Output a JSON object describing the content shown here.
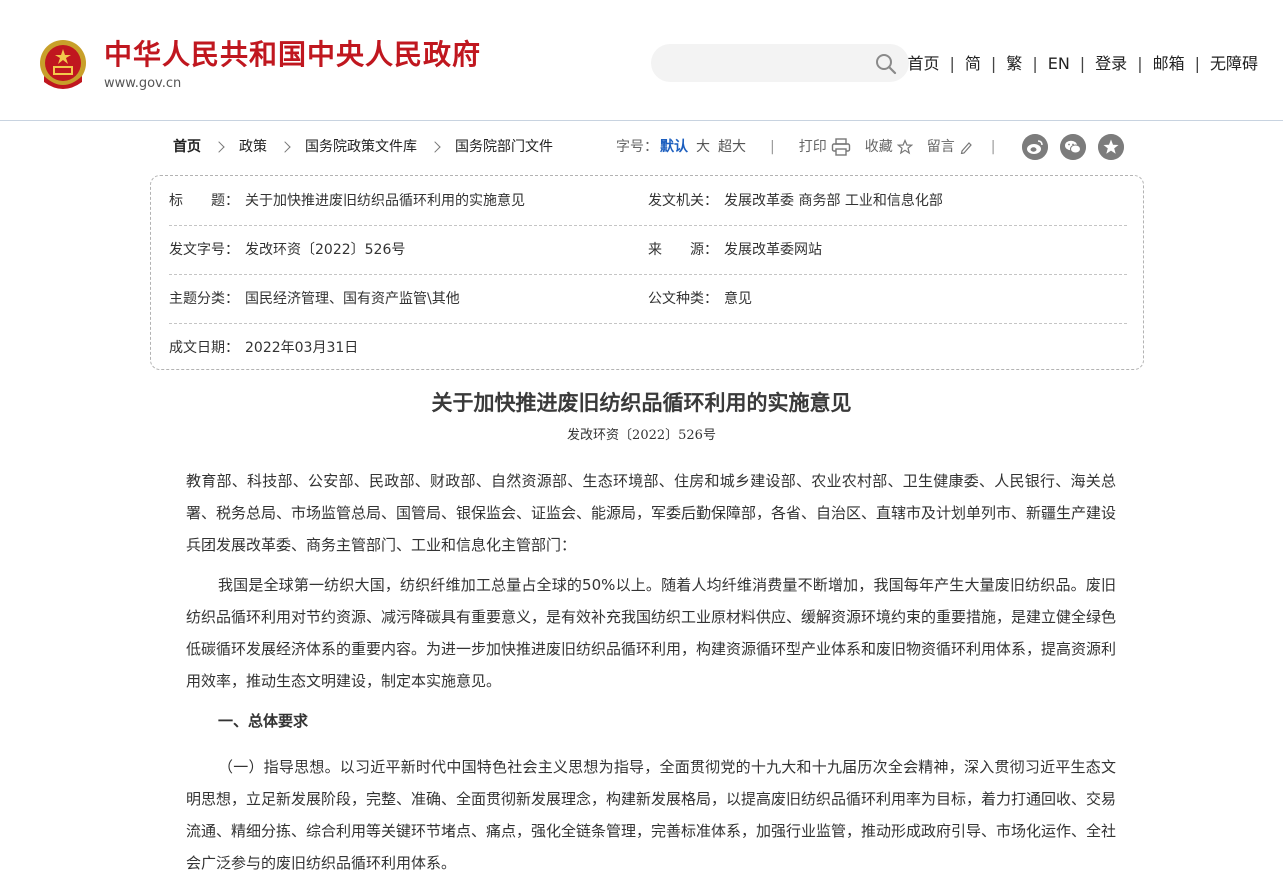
{
  "header": {
    "site_name": "中华人民共和国中央人民政府",
    "site_url": "www.gov.cn",
    "search": {
      "value": "",
      "placeholder": ""
    },
    "nav": [
      "首页",
      "简",
      "繁",
      "EN",
      "登录",
      "邮箱",
      "无障碍"
    ],
    "nav_separator": "|",
    "brand_color": "#c0171f"
  },
  "breadcrumb": [
    "首页",
    "政策",
    "国务院政策文件库",
    "国务院部门文件"
  ],
  "toolbar": {
    "font_size_label": "字号：",
    "font_sizes": [
      "默认",
      "大",
      "超大"
    ],
    "print_label": "打印",
    "favorite_label": "收藏",
    "comment_label": "留言",
    "separator": "|",
    "share_icons": [
      "weibo-icon",
      "wechat-icon",
      "favorite-star-icon"
    ]
  },
  "meta": {
    "title_label": "标　　题：",
    "title_value": "关于加快推进废旧纺织品循环利用的实施意见",
    "issuer_label": "发文机关：",
    "issuer_value": "发展改革委 商务部 工业和信息化部",
    "docno_label": "发文字号：",
    "docno_value": "发改环资〔2022〕526号",
    "source_label": "来　　源：",
    "source_value": "发展改革委网站",
    "topic_label": "主题分类：",
    "topic_value": "国民经济管理、国有资产监管\\其他",
    "type_label": "公文种类：",
    "type_value": "意见",
    "date_label": "成文日期：",
    "date_value": "2022年03月31日"
  },
  "article": {
    "title": "关于加快推进废旧纺织品循环利用的实施意见",
    "docno": "发改环资〔2022〕526号",
    "addressee": "教育部、科技部、公安部、民政部、财政部、自然资源部、生态环境部、住房和城乡建设部、农业农村部、卫生健康委、人民银行、海关总署、税务总局、市场监管总局、国管局、银保监会、证监会、能源局，军委后勤保障部，各省、自治区、直辖市及计划单列市、新疆生产建设兵团发展改革委、商务主管部门、工业和信息化主管部门：",
    "intro": "我国是全球第一纺织大国，纺织纤维加工总量占全球的50%以上。随着人均纤维消费量不断增加，我国每年产生大量废旧纺织品。废旧纺织品循环利用对节约资源、减污降碳具有重要意义，是有效补充我国纺织工业原材料供应、缓解资源环境约束的重要措施，是建立健全绿色低碳循环发展经济体系的重要内容。为进一步加快推进废旧纺织品循环利用，构建资源循环型产业体系和废旧物资循环利用体系，提高资源利用效率，推动生态文明建设，制定本实施意见。",
    "section1_heading": "一、总体要求",
    "section1_p1": "（一）指导思想。以习近平新时代中国特色社会主义思想为指导，全面贯彻党的十九大和十九届历次全会精神，深入贯彻习近平生态文明思想，立足新发展阶段，完整、准确、全面贯彻新发展理念，构建新发展格局，以提高废旧纺织品循环利用率为目标，着力打通回收、交易流通、精细分拣、综合利用等关键环节堵点、痛点，强化全链条管理，完善标准体系，加强行业监管，推动形成政府引导、市场化运作、全社会广泛参与的废旧纺织品循环利用体系。"
  }
}
